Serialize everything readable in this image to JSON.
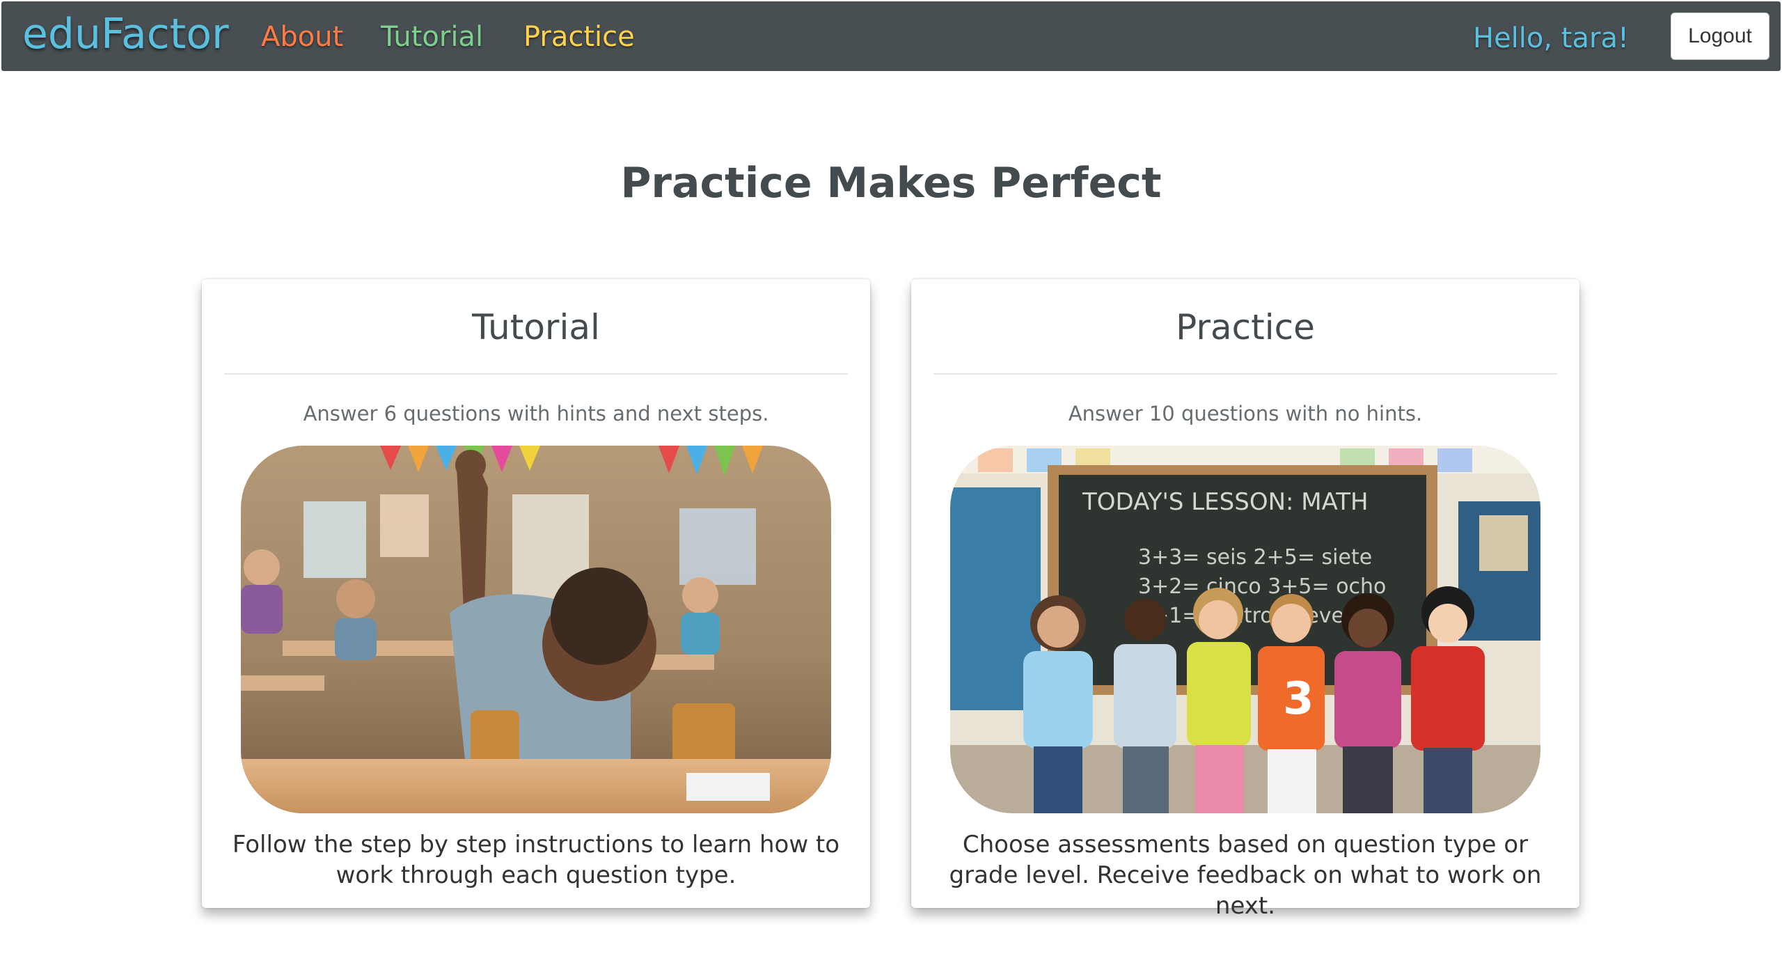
{
  "navbar": {
    "brand": "eduFactor",
    "links": [
      {
        "label": "About"
      },
      {
        "label": "Tutorial"
      },
      {
        "label": "Practice"
      }
    ],
    "greeting": "Hello, tara!",
    "logout_label": "Logout",
    "colors": {
      "background": "#484f53",
      "brand": "#5bc0de",
      "about": "#ff7a45",
      "tutorial": "#7ed08e",
      "practice": "#ffd24a"
    }
  },
  "main": {
    "title": "Practice Makes Perfect",
    "cards": [
      {
        "title": "Tutorial",
        "subtitle": "Answer 6 questions with hints and next steps.",
        "image": "photo-classroom-student-raising-hand",
        "description": "Follow the step by step instructions to learn how to work through each question type."
      },
      {
        "title": "Practice",
        "subtitle": "Answer 10 questions with no hints.",
        "image": "photo-children-in-front-of-chalkboard",
        "chalkboard": {
          "heading": "TODAY'S LESSON: MATH",
          "lines": [
            "3+3= seis   2+5= siete",
            "3+2= cinco  3+5= ocho",
            "3+1= cuatro       nueve"
          ],
          "shirt_number": "3"
        },
        "description": "Choose assessments based on question type or grade level. Receive feedback on what to work on next."
      }
    ]
  }
}
